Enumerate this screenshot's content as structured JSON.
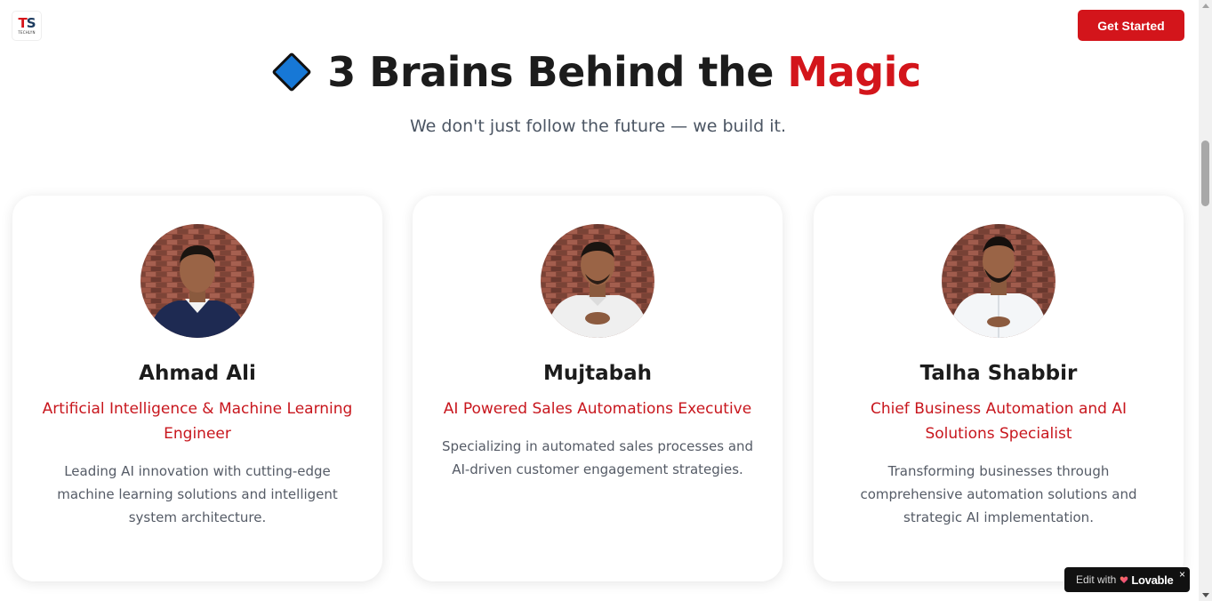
{
  "header": {
    "logo_text_t": "T",
    "logo_text_s": "S",
    "logo_sub": "TECHLYN",
    "cta_label": "Get Started"
  },
  "hero": {
    "title_main": "3 Brains Behind the",
    "title_accent": "Magic",
    "tagline": "We don't just follow the future — we build it."
  },
  "team": [
    {
      "name": "Ahmad Ali",
      "role": "Artificial Intelligence & Machine Learning Engineer",
      "description": "Leading AI innovation with cutting-edge machine learning solutions and intelligent system architecture."
    },
    {
      "name": "Mujtabah",
      "role": "AI Powered Sales Automations Executive",
      "description": "Specializing in automated sales processes and AI-driven customer engagement strategies."
    },
    {
      "name": "Talha Shabbir",
      "role": "Chief Business Automation and AI Solutions Specialist",
      "description": "Transforming businesses through comprehensive automation solutions and strategic AI implementation."
    }
  ],
  "badge": {
    "prefix": "Edit with",
    "brand": "Lovable",
    "close": "×"
  },
  "colors": {
    "accent": "#d3151b",
    "diamond": "#1778d6"
  }
}
